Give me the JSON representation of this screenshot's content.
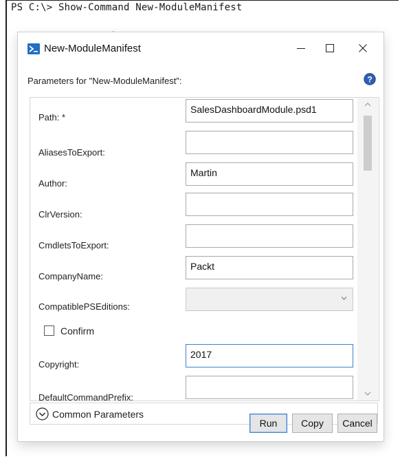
{
  "console": {
    "command_line": "PS C:\\> Show-Command New-ModuleManifest"
  },
  "window": {
    "title": "New-ModuleManifest"
  },
  "header": {
    "params_label": "Parameters for \"New-ModuleManifest\":"
  },
  "params": {
    "path": {
      "label": "Path: *",
      "value": "SalesDashboardModule.psd1"
    },
    "aliases": {
      "label": "AliasesToExport:",
      "value": ""
    },
    "author": {
      "label": "Author:",
      "value": "Martin"
    },
    "clr": {
      "label": "ClrVersion:",
      "value": ""
    },
    "cmdlets": {
      "label": "CmdletsToExport:",
      "value": ""
    },
    "company": {
      "label": "CompanyName:",
      "value": "Packt"
    },
    "editions": {
      "label": "CompatiblePSEditions:",
      "value": ""
    },
    "confirm": {
      "label": "Confirm",
      "checked": false
    },
    "copyright": {
      "label": "Copyright:",
      "value": "2017"
    },
    "prefix": {
      "label": "DefaultCommandPrefix:",
      "value": ""
    }
  },
  "common": {
    "label": "Common Parameters"
  },
  "buttons": {
    "run": "Run",
    "copy": "Copy",
    "cancel": "Cancel"
  },
  "colors": {
    "accent": "#3f7fd0",
    "help_icon": "#2f5fb3",
    "app_icon": "#1f6fc4"
  }
}
